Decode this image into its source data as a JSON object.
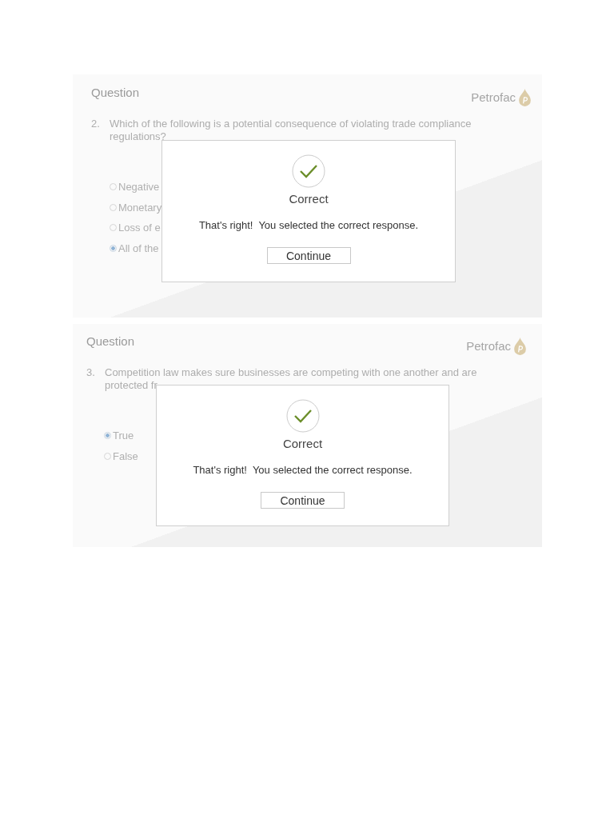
{
  "slides": [
    {
      "heading": "Question",
      "logo": {
        "text": "Petrofac"
      },
      "question": {
        "number": "2.",
        "text": "Which of the following is a potential consequence of violating trade compliance regulations?"
      },
      "options": [
        {
          "label": "Negative",
          "selected": false
        },
        {
          "label": "Monetary",
          "selected": false
        },
        {
          "label": "Loss of e",
          "selected": false
        },
        {
          "label": "All of the",
          "selected": true
        }
      ],
      "dialog": {
        "title": "Correct",
        "message": "That's right!  You selected the correct response.",
        "button": "Continue"
      }
    },
    {
      "heading": "Question",
      "logo": {
        "text": "Petrofac"
      },
      "question": {
        "number": "3.",
        "text": "Competition law makes sure businesses are competing with one another and are protected fr"
      },
      "options": [
        {
          "label": "True",
          "selected": true
        },
        {
          "label": "False",
          "selected": false
        }
      ],
      "dialog": {
        "title": "Correct",
        "message": "That's right!  You selected the correct response.",
        "button": "Continue"
      }
    }
  ]
}
